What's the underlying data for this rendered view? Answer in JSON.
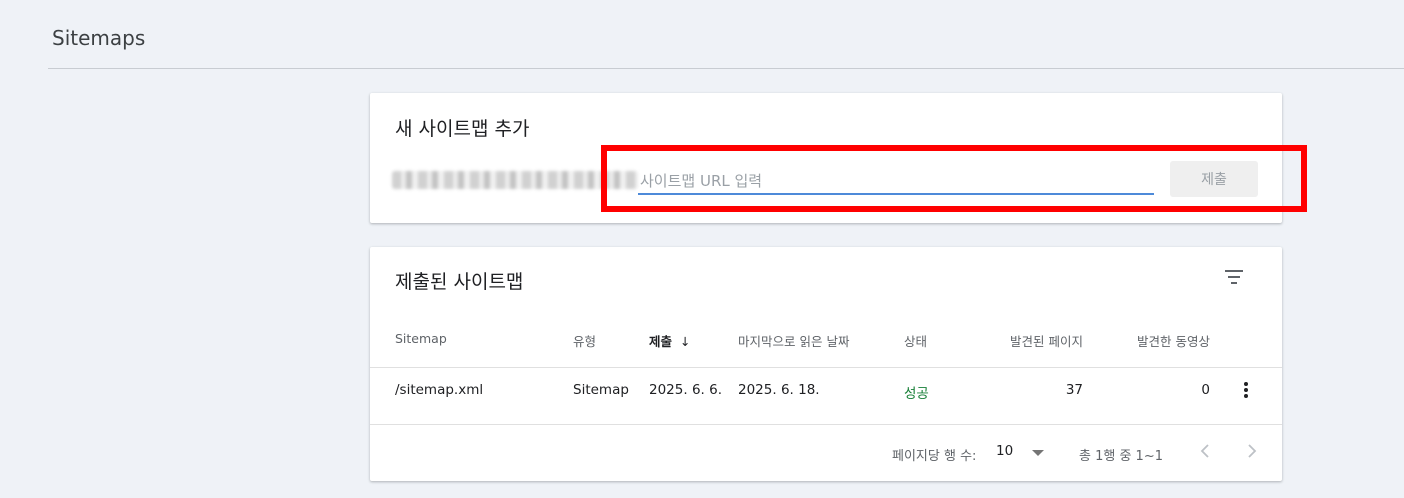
{
  "page": {
    "title": "Sitemaps"
  },
  "add_card": {
    "title": "새 사이트맵 추가",
    "input_placeholder": "사이트맵 URL 입력",
    "input_value": "",
    "submit_label": "제출"
  },
  "list_card": {
    "title": "제출된 사이트맵",
    "columns": {
      "sitemap": "Sitemap",
      "type": "유형",
      "submitted": "제출",
      "last_read": "마지막으로 읽은 날짜",
      "status": "상태",
      "pages_found": "발견된 페이지",
      "videos_found": "발견한 동영상"
    },
    "sort_arrow": "↓",
    "rows": [
      {
        "sitemap": "/sitemap.xml",
        "type": "Sitemap",
        "submitted": "2025. 6. 6.",
        "last_read": "2025. 6. 18.",
        "status": "성공",
        "pages_found": "37",
        "videos_found": "0"
      }
    ],
    "footer": {
      "rows_per_page_label": "페이지당 행 수:",
      "rows_per_page_value": "10",
      "range_text": "총 1행 중 1~1"
    }
  },
  "colors": {
    "background": "#eff2f7",
    "input_underline": "#4d8ad9",
    "success": "#188038",
    "highlight": "#ff0000"
  }
}
